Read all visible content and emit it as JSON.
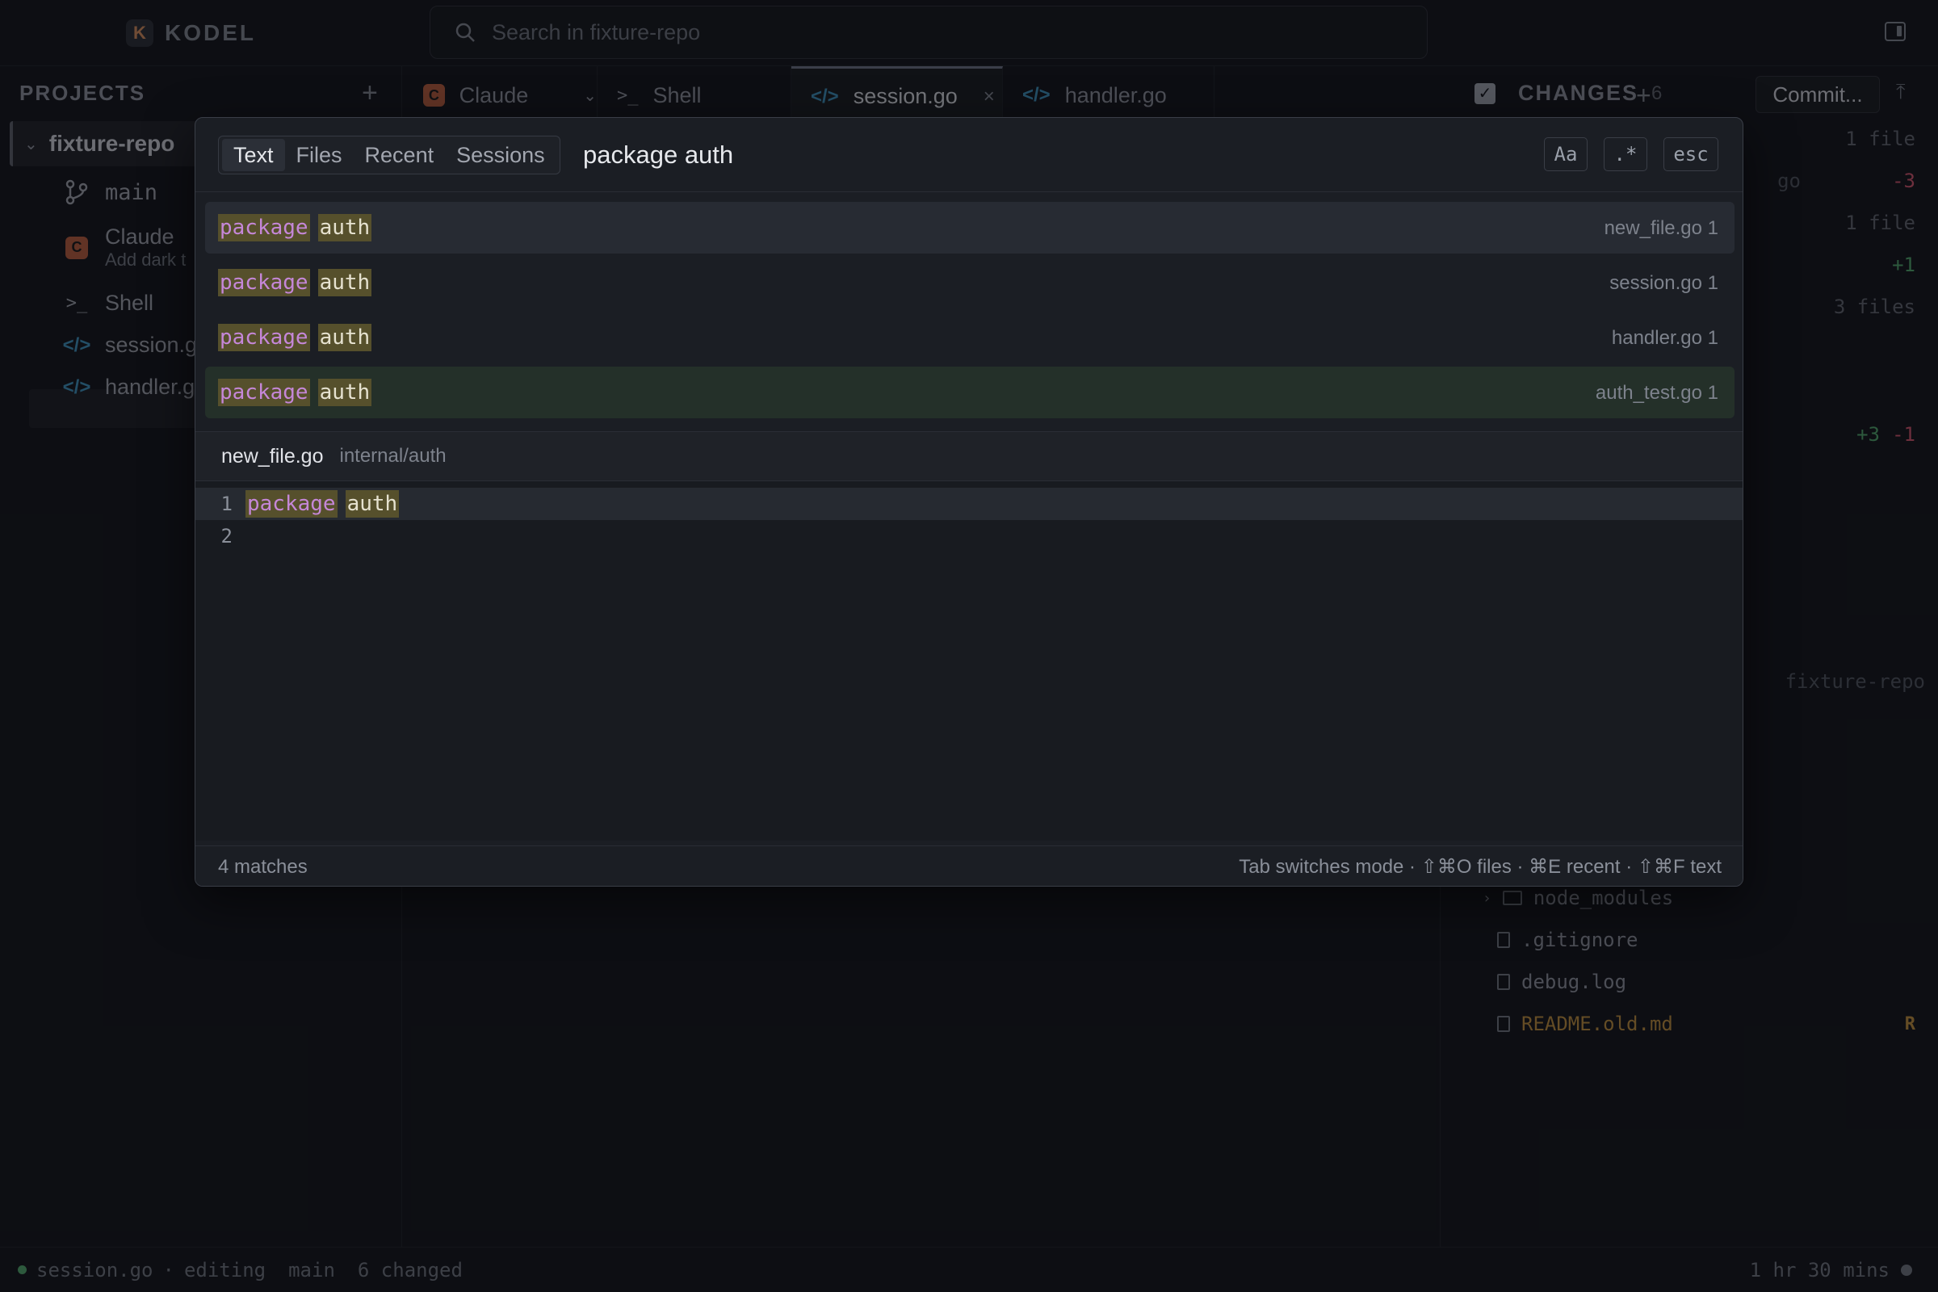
{
  "app": {
    "brand_letter": "K",
    "brand_name": "KODEL",
    "search_placeholder": "Search in fixture-repo"
  },
  "sidebar": {
    "header": "PROJECTS",
    "add": "+",
    "project": "fixture-repo",
    "items": [
      {
        "label": "main",
        "icon": "branch-icon"
      },
      {
        "label": "Claude",
        "sub": "Add dark t",
        "icon": "claude-badge"
      },
      {
        "label": "Shell",
        "icon": "terminal-icon"
      },
      {
        "label": "session.g",
        "icon": "code-icon"
      },
      {
        "label": "handler.g",
        "icon": "code-icon"
      }
    ]
  },
  "tabs": [
    {
      "label": "Claude",
      "icon": "claude-badge",
      "active": false
    },
    {
      "label": "Shell",
      "icon": "terminal-icon",
      "active": false
    },
    {
      "label": "session.go",
      "icon": "code-icon",
      "active": true,
      "close": "×"
    },
    {
      "label": "handler.go",
      "icon": "code-icon",
      "active": false
    }
  ],
  "tab_add": "+",
  "right_panel": {
    "title": "CHANGES",
    "count": "6",
    "commit_label": "Commit...",
    "lines": [
      {
        "text": "1 file"
      },
      {
        "text": "go",
        "del": "-3"
      },
      {
        "text": "1 file"
      },
      {
        "add": "+1"
      },
      {
        "text": "3 files"
      },
      {
        "add": "+3",
        "del": "-1"
      }
    ],
    "repo": "fixture-repo",
    "tree": [
      {
        "label": "node_modules",
        "type": "folder"
      },
      {
        "label": ".gitignore",
        "type": "file"
      },
      {
        "label": "debug.log",
        "type": "file"
      },
      {
        "label": "README.old.md",
        "type": "file",
        "status": "R"
      }
    ]
  },
  "statusbar": {
    "file": "session.go",
    "sep": "·",
    "mode": "editing",
    "branch": "main",
    "changed": "6 changed",
    "time": "1 hr 30 mins"
  },
  "palette": {
    "modes": [
      "Text",
      "Files",
      "Recent",
      "Sessions"
    ],
    "active_mode": "Text",
    "query": "package auth",
    "options": {
      "case": "Aa",
      "regex": ".*",
      "esc": "esc"
    },
    "results": [
      {
        "kw": "package",
        "id": "auth",
        "meta": "new_file.go 1"
      },
      {
        "kw": "package",
        "id": "auth",
        "meta": "session.go 1"
      },
      {
        "kw": "package",
        "id": "auth",
        "meta": "handler.go 1"
      },
      {
        "kw": "package",
        "id": "auth",
        "meta": "auth_test.go 1"
      }
    ],
    "preview": {
      "file": "new_file.go",
      "dir": "internal/auth",
      "lines": [
        {
          "n": "1",
          "kw": "package",
          "id": "auth"
        },
        {
          "n": "2",
          "kw": "",
          "id": ""
        }
      ]
    },
    "footer": {
      "count": "4 matches",
      "hint": "Tab switches mode · ⇧⌘O files · ⌘E recent · ⇧⌘F text"
    }
  }
}
